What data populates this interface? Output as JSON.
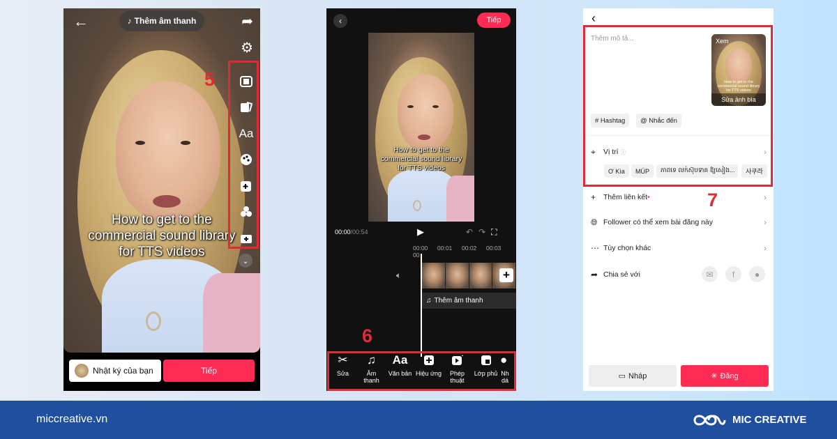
{
  "panel1": {
    "audio_pill": "Thêm âm thanh",
    "caption": [
      "How to get to the",
      "commercial sound library",
      "for TTS videos"
    ],
    "diary_label": "Nhật ký của bạn",
    "next_label": "Tiếp",
    "step_number": "5",
    "toolbar_icons": [
      "template-icon",
      "sticker-icon",
      "text-icon",
      "filter-icon",
      "effects-icon",
      "voice-effects-icon",
      "add-clip-icon"
    ]
  },
  "panel2": {
    "next_label": "Tiếp",
    "caption": [
      "How to get to the",
      "commercial sound library",
      "for TTS videos"
    ],
    "time_current": "00:00",
    "time_total": "/00:54",
    "ticks": [
      "00:00",
      "00:01",
      "00:02",
      "00:03",
      "00"
    ],
    "audio_track": "Thêm âm thanh",
    "step_number": "6",
    "tools": [
      {
        "icon": "scissors-icon",
        "label": "Sửa"
      },
      {
        "icon": "music-icon",
        "label": "Âm thanh"
      },
      {
        "icon": "text-icon",
        "label": "Văn bản"
      },
      {
        "icon": "effects-icon",
        "label": "Hiệu ứng"
      },
      {
        "icon": "magic-icon",
        "label": "Phép thuật"
      },
      {
        "icon": "overlay-icon",
        "label": "Lớp phủ"
      },
      {
        "icon": "more-icon",
        "label": "Nh dá"
      }
    ]
  },
  "panel3": {
    "description_placeholder": "Thêm mô tả...",
    "thumb_view": "Xem",
    "thumb_cover": "Sửa ảnh bìa",
    "hashtag_chip": "# Hashtag",
    "mention_chip": "@ Nhắc đến",
    "location_label": "Vị trí",
    "location_chips": [
      "Ơ Kìa",
      "MÚP",
      "ភាពទេ លក់ស៊ុបទាគ ឱ្យសៀង...",
      "사쿠라"
    ],
    "add_link": "Thêm liên kết",
    "followers_label": "Follower có thể xem bài đăng này",
    "more_options": "Tùy chọn khác",
    "share_with": "Chia sẻ với",
    "draft_label": "Nháp",
    "post_label": "Đăng",
    "step_number": "7"
  },
  "footer": {
    "site": "miccreative.vn",
    "brand": "MIC CREATIVE"
  },
  "colors": {
    "accent_red": "#fe2c55",
    "highlight_red": "#e02b36",
    "footer_blue": "#1f4f9e"
  }
}
